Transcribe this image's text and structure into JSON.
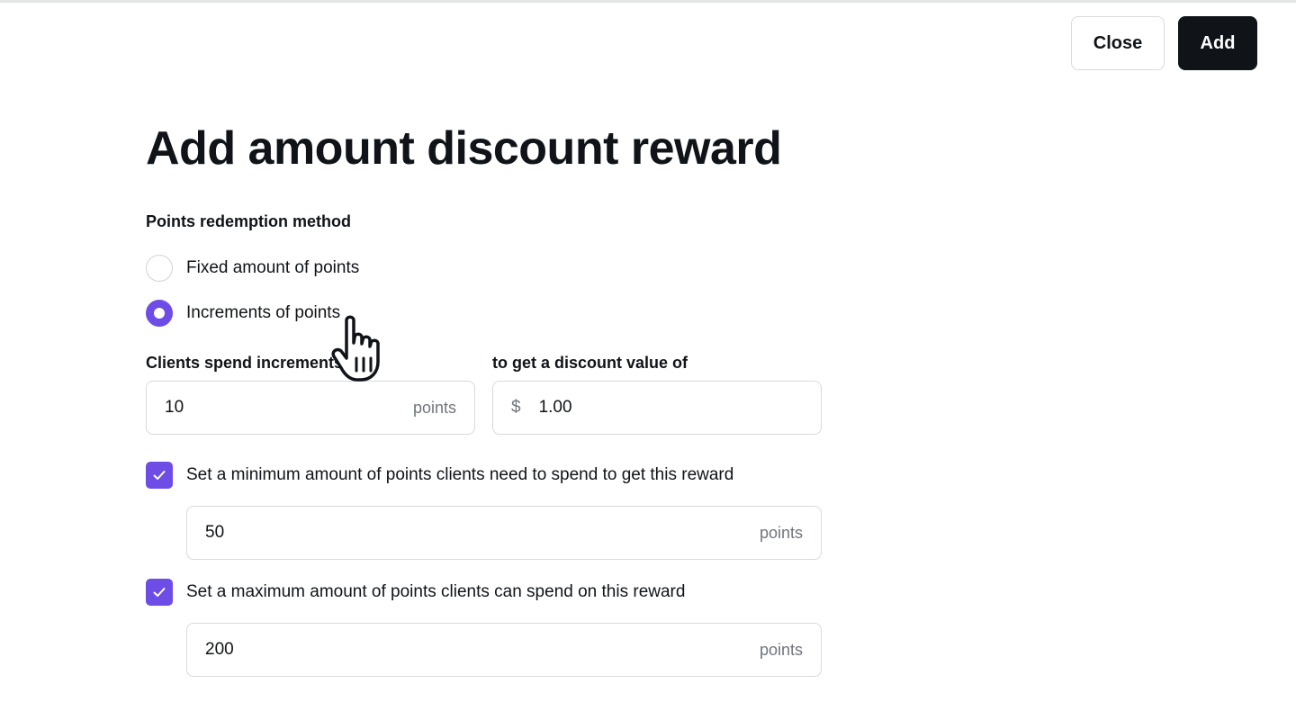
{
  "header": {
    "close_label": "Close",
    "add_label": "Add"
  },
  "page": {
    "title": "Add amount discount reward"
  },
  "redemption": {
    "label": "Points redemption method",
    "options": [
      {
        "label": "Fixed amount of points",
        "selected": false
      },
      {
        "label": "Increments of points",
        "selected": true
      }
    ]
  },
  "increments": {
    "spend_label": "Clients spend increments",
    "spend_value": "10",
    "spend_suffix": "points",
    "discount_label": "to get a discount value of",
    "discount_prefix": "$",
    "discount_value": "1.00"
  },
  "minimum": {
    "checked": true,
    "label": "Set a minimum amount of points clients need to spend to get this reward",
    "value": "50",
    "suffix": "points"
  },
  "maximum": {
    "checked": true,
    "label": "Set a maximum amount of points clients can spend on this reward",
    "value": "200",
    "suffix": "points"
  },
  "colors": {
    "accent": "#6e4de6",
    "primary": "#101418",
    "border": "#d9dadd",
    "muted": "#70757d"
  },
  "icons": {
    "cursor": "hand-pointer-icon",
    "check": "checkmark-icon"
  }
}
